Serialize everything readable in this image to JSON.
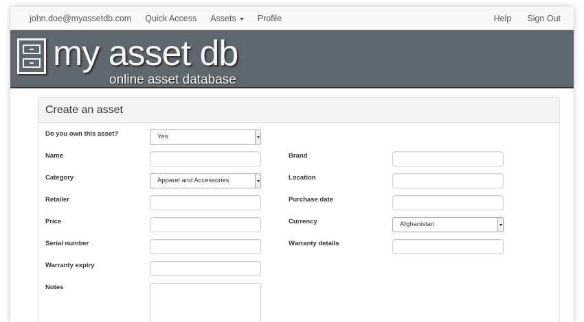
{
  "navbar": {
    "user_email": "john.doe@myassetdb.com",
    "quick_access": "Quick Access",
    "assets": "Assets",
    "profile": "Profile",
    "help": "Help",
    "sign_out": "Sign Out"
  },
  "banner": {
    "title": "my asset db",
    "subtitle": "online asset database",
    "logo_icon": "filing-cabinet-icon"
  },
  "form": {
    "heading": "Create an asset",
    "own_label": "Do you own this asset?",
    "own_value": "Yes",
    "name_label": "Name",
    "category_label": "Category",
    "category_value": "Apparel and Accessories",
    "retailer_label": "Retailer",
    "price_label": "Price",
    "serial_label": "Serial number",
    "warranty_expiry_label": "Warranty expiry",
    "notes_label": "Notes",
    "brand_label": "Brand",
    "location_label": "Location",
    "purchase_date_label": "Purchase date",
    "currency_label": "Currency",
    "currency_value": "Afghanistan",
    "warranty_details_label": "Warranty details"
  },
  "colors": {
    "banner_bg": "#5e676d",
    "navbar_bg": "#f8f8f8"
  }
}
